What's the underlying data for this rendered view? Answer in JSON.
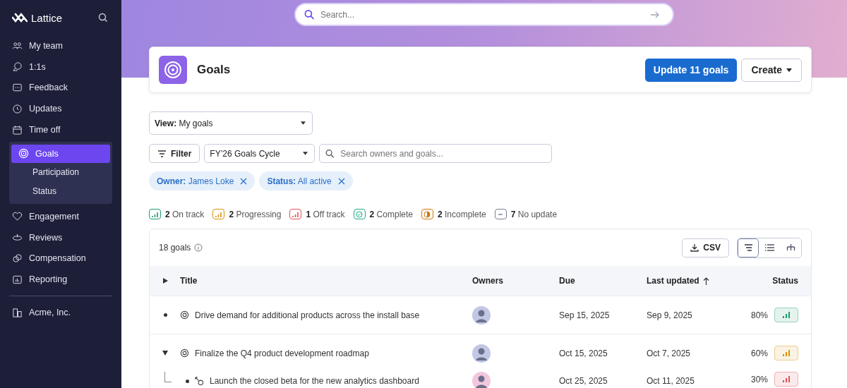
{
  "app": {
    "name": "Lattice"
  },
  "sidebar": {
    "items": [
      {
        "label": "My team",
        "selected": false
      },
      {
        "label": "1:1s",
        "selected": false
      },
      {
        "label": "Feedback",
        "selected": false
      },
      {
        "label": "Updates",
        "selected": false
      },
      {
        "label": "Time off",
        "selected": false
      },
      {
        "label": "Goals",
        "selected": true,
        "expanded": true,
        "children": [
          {
            "label": "Participation",
            "selected": false
          },
          {
            "label": "Status",
            "selected": false
          }
        ]
      },
      {
        "label": "Engagement",
        "selected": false
      },
      {
        "label": "Reviews",
        "selected": false
      },
      {
        "label": "Compensation",
        "selected": false
      },
      {
        "label": "Reporting",
        "selected": false
      }
    ],
    "footer": {
      "label": "Acme, Inc."
    }
  },
  "search": {
    "placeholder": "Search..."
  },
  "header": {
    "title": "Goals",
    "primary_button": "Update 11 goals",
    "create_button": "Create"
  },
  "view_select": {
    "label": "View:",
    "value": "My goals"
  },
  "filter_button": "Filter",
  "cycle_select": {
    "value": "FY’26 Goals Cycle"
  },
  "owner_search": {
    "placeholder": "Search owners and goals..."
  },
  "chips": [
    {
      "key": "Owner:",
      "value": "James Loke"
    },
    {
      "key": "Status:",
      "value": "All active"
    }
  ],
  "status_summary": [
    {
      "kind": "bars",
      "count": "2",
      "label": "On track",
      "color": "#1f9d6b"
    },
    {
      "kind": "bars",
      "count": "2",
      "label": "Progressing",
      "color": "#d9920b"
    },
    {
      "kind": "bars",
      "count": "1",
      "label": "Off track",
      "color": "#e0525a"
    },
    {
      "kind": "check",
      "count": "2",
      "label": "Complete",
      "color": "#22a88a"
    },
    {
      "kind": "half",
      "count": "2",
      "label": "Incomplete",
      "color": "#d2770c"
    },
    {
      "kind": "dash",
      "count": "7",
      "label": "No update",
      "color": "#7a7f99"
    }
  ],
  "table": {
    "count": "18 goals",
    "csv_button": "CSV",
    "view_toggle": [
      {
        "kind": "tree",
        "selected": true
      },
      {
        "kind": "list",
        "selected": false
      },
      {
        "kind": "org",
        "selected": false
      }
    ],
    "columns": [
      {
        "label": "Title",
        "sorted": false
      },
      {
        "label": "Owners",
        "sorted": false
      },
      {
        "label": "Due",
        "sorted": false
      },
      {
        "label": "Last updated",
        "sorted": true
      },
      {
        "label": "Status",
        "sorted": false
      }
    ],
    "rows": [
      {
        "kind": "goal",
        "title": "Drive demand for additional products across the install base",
        "expanded": false,
        "due": "Sep 15, 2025",
        "updated": "Sep 9, 2025",
        "progress": "80%",
        "color": "#1f9d6b"
      },
      {
        "kind": "goal",
        "title": "Finalize the Q4 product development roadmap",
        "expanded": true,
        "due": "Oct 15, 2025",
        "updated": "Oct 7, 2025",
        "progress": "60%",
        "color": "#d9920b",
        "children": [
          {
            "kind": "subgoal",
            "title": "Launch the closed beta for the new analytics dashboard",
            "expanded": false,
            "due": "Oct 25, 2025",
            "updated": "Oct 11, 2025",
            "progress": "30%",
            "color": "#e0525a"
          }
        ]
      }
    ]
  }
}
